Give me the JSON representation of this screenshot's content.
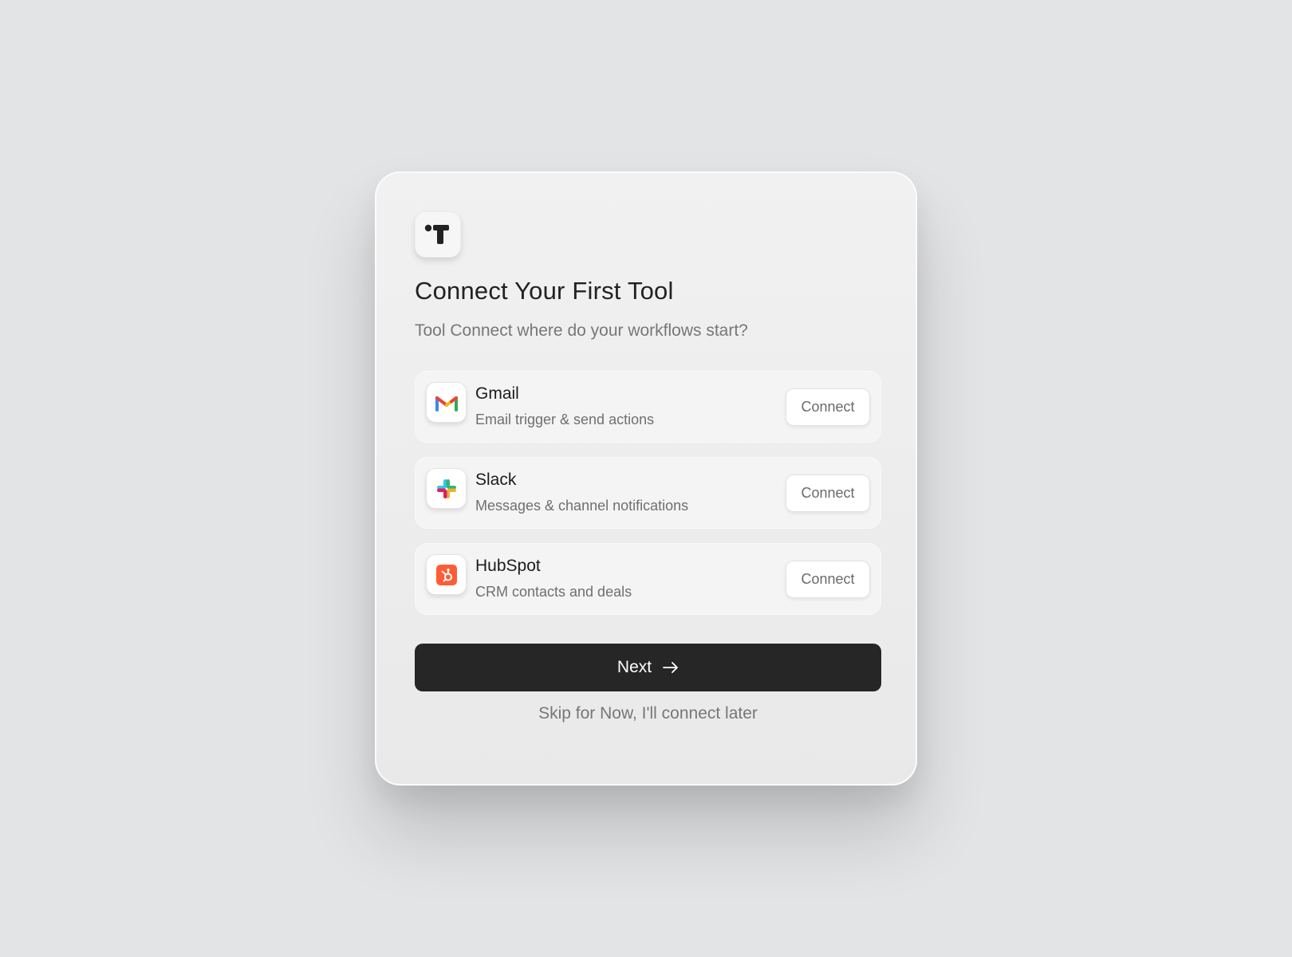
{
  "brand": {
    "logo_icon": "brand-logo-icon"
  },
  "header": {
    "title": "Connect Your First Tool",
    "subtitle": "Tool Connect where do your workflows start?"
  },
  "tools": [
    {
      "name": "Gmail",
      "description": "Email trigger & send actions",
      "icon": "gmail-icon",
      "button_label": "Connect"
    },
    {
      "name": "Slack",
      "description": "Messages & channel notifications",
      "icon": "slack-icon",
      "button_label": "Connect"
    },
    {
      "name": "HubSpot",
      "description": "CRM contacts and deals",
      "icon": "hubspot-icon",
      "button_label": "Connect"
    }
  ],
  "actions": {
    "next_label": "Next",
    "next_icon": "arrow-right-icon",
    "skip_label": "Skip for Now, I'll connect later"
  },
  "colors": {
    "primary_button": "#262626",
    "hubspot": "#ff5c35",
    "background": "#e3e4e6"
  }
}
